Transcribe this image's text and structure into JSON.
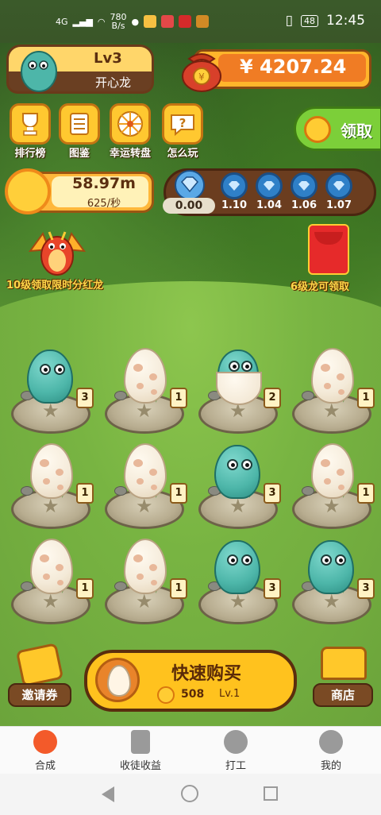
{
  "status_bar": {
    "signal": "4G",
    "speed_value": "780",
    "speed_unit": "B/s",
    "battery": "48",
    "time": "12:45"
  },
  "profile": {
    "level": "Lv3",
    "name": "开心龙"
  },
  "money": {
    "amount": "¥ 4207.24"
  },
  "menu": [
    {
      "label": "排行榜",
      "icon": "trophy-icon"
    },
    {
      "label": "图鉴",
      "icon": "book-icon"
    },
    {
      "label": "幸运转盘",
      "icon": "wheel-icon"
    },
    {
      "label": "怎么玩",
      "icon": "question-icon"
    }
  ],
  "collect": {
    "label": "领取"
  },
  "rate": {
    "value": "58.97m",
    "per_sec": "625/秒"
  },
  "gems": {
    "current": "0.00",
    "slots": [
      "1.10",
      "1.04",
      "1.06",
      "1.07"
    ]
  },
  "promos": {
    "left": "10级领取限时分红龙",
    "right": "6级龙可领取"
  },
  "grid": [
    {
      "type": "dino",
      "badge": "3"
    },
    {
      "type": "egg",
      "badge": "1"
    },
    {
      "type": "hatching",
      "badge": "2"
    },
    {
      "type": "egg",
      "badge": "1"
    },
    {
      "type": "egg",
      "badge": "1"
    },
    {
      "type": "egg",
      "badge": "1"
    },
    {
      "type": "dino",
      "badge": "3"
    },
    {
      "type": "egg",
      "badge": "1"
    },
    {
      "type": "egg",
      "badge": "1"
    },
    {
      "type": "egg",
      "badge": "1"
    },
    {
      "type": "dino",
      "badge": "3"
    },
    {
      "type": "dino",
      "badge": "3"
    }
  ],
  "actions": {
    "invite_label": "邀请券",
    "buy_title": "快速购买",
    "buy_price": "508",
    "buy_level": "Lv.1",
    "shop_label": "商店"
  },
  "tabs": [
    {
      "label": "合成",
      "active": true
    },
    {
      "label": "收徒收益",
      "active": false
    },
    {
      "label": "打工",
      "active": false
    },
    {
      "label": "我的",
      "active": false
    }
  ],
  "colors": {
    "accent_orange": "#f07c24",
    "gold": "#ffc21e",
    "brown": "#6a3f22",
    "teal_dino": "#4db6a9",
    "tab_active": "#f35a2a"
  }
}
